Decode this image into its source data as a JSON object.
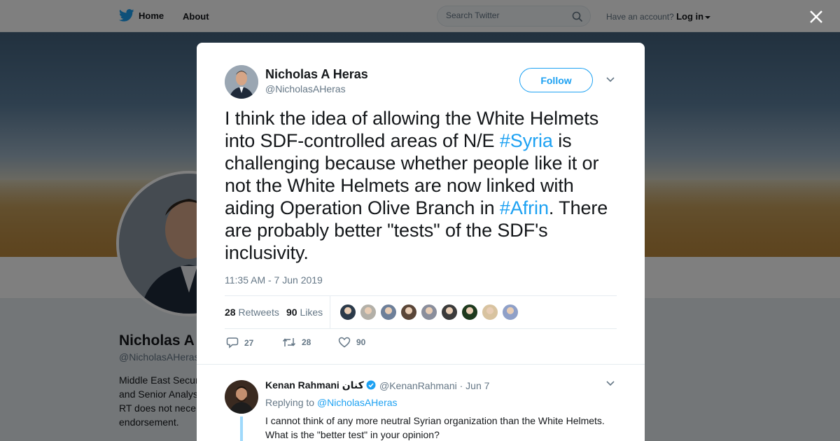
{
  "nav": {
    "home": "Home",
    "about": "About",
    "search_placeholder": "Search Twitter",
    "account_prompt": "Have an account?",
    "login": "Log in"
  },
  "profile": {
    "name": "Nicholas A",
    "handle": "@NicholasAHeras",
    "bio_lines": [
      "Middle East Secur",
      "and Senior Analys",
      "RT does not nece",
      "endorsement."
    ]
  },
  "tweet": {
    "author_name": "Nicholas A Heras",
    "author_handle": "@NicholasAHeras",
    "follow_label": "Follow",
    "text_part1": "I think the idea of allowing the White Helmets into SDF-controlled areas of N/E ",
    "hashtag1": "#Syria",
    "text_part2": " is challenging because whether people like it or not the White Helmets are now linked with aiding Operation Olive Branch in ",
    "hashtag2": "#Afrin",
    "text_part3": ". There are probably better \"tests\" of the SDF's inclusivity.",
    "timestamp": "11:35 AM - 7 Jun 2019",
    "retweets_count": "28",
    "retweets_label": "Retweets",
    "likes_count": "90",
    "likes_label": "Likes",
    "reply_count": "27",
    "retweet_action_count": "28",
    "like_action_count": "90",
    "liker_colors": [
      "#2b3a4a",
      "#b3b0a8",
      "#6d7f99",
      "#5a4638",
      "#8a8e9c",
      "#3b3b3b",
      "#1e3a1e",
      "#d8c3a0",
      "#8fa0c8"
    ]
  },
  "reply": {
    "name": "Kenan Rahmani كنان",
    "handle": "@KenanRahmani · Jun 7",
    "replying_prefix": "Replying to ",
    "replying_to": "@NicholasAHeras",
    "text": "I cannot think of any more neutral Syrian  organization than the White Helmets. What is the \"better test\" in your opinion?"
  },
  "colors": {
    "accent": "#1da1f2",
    "text": "#14171a",
    "muted": "#657786"
  }
}
